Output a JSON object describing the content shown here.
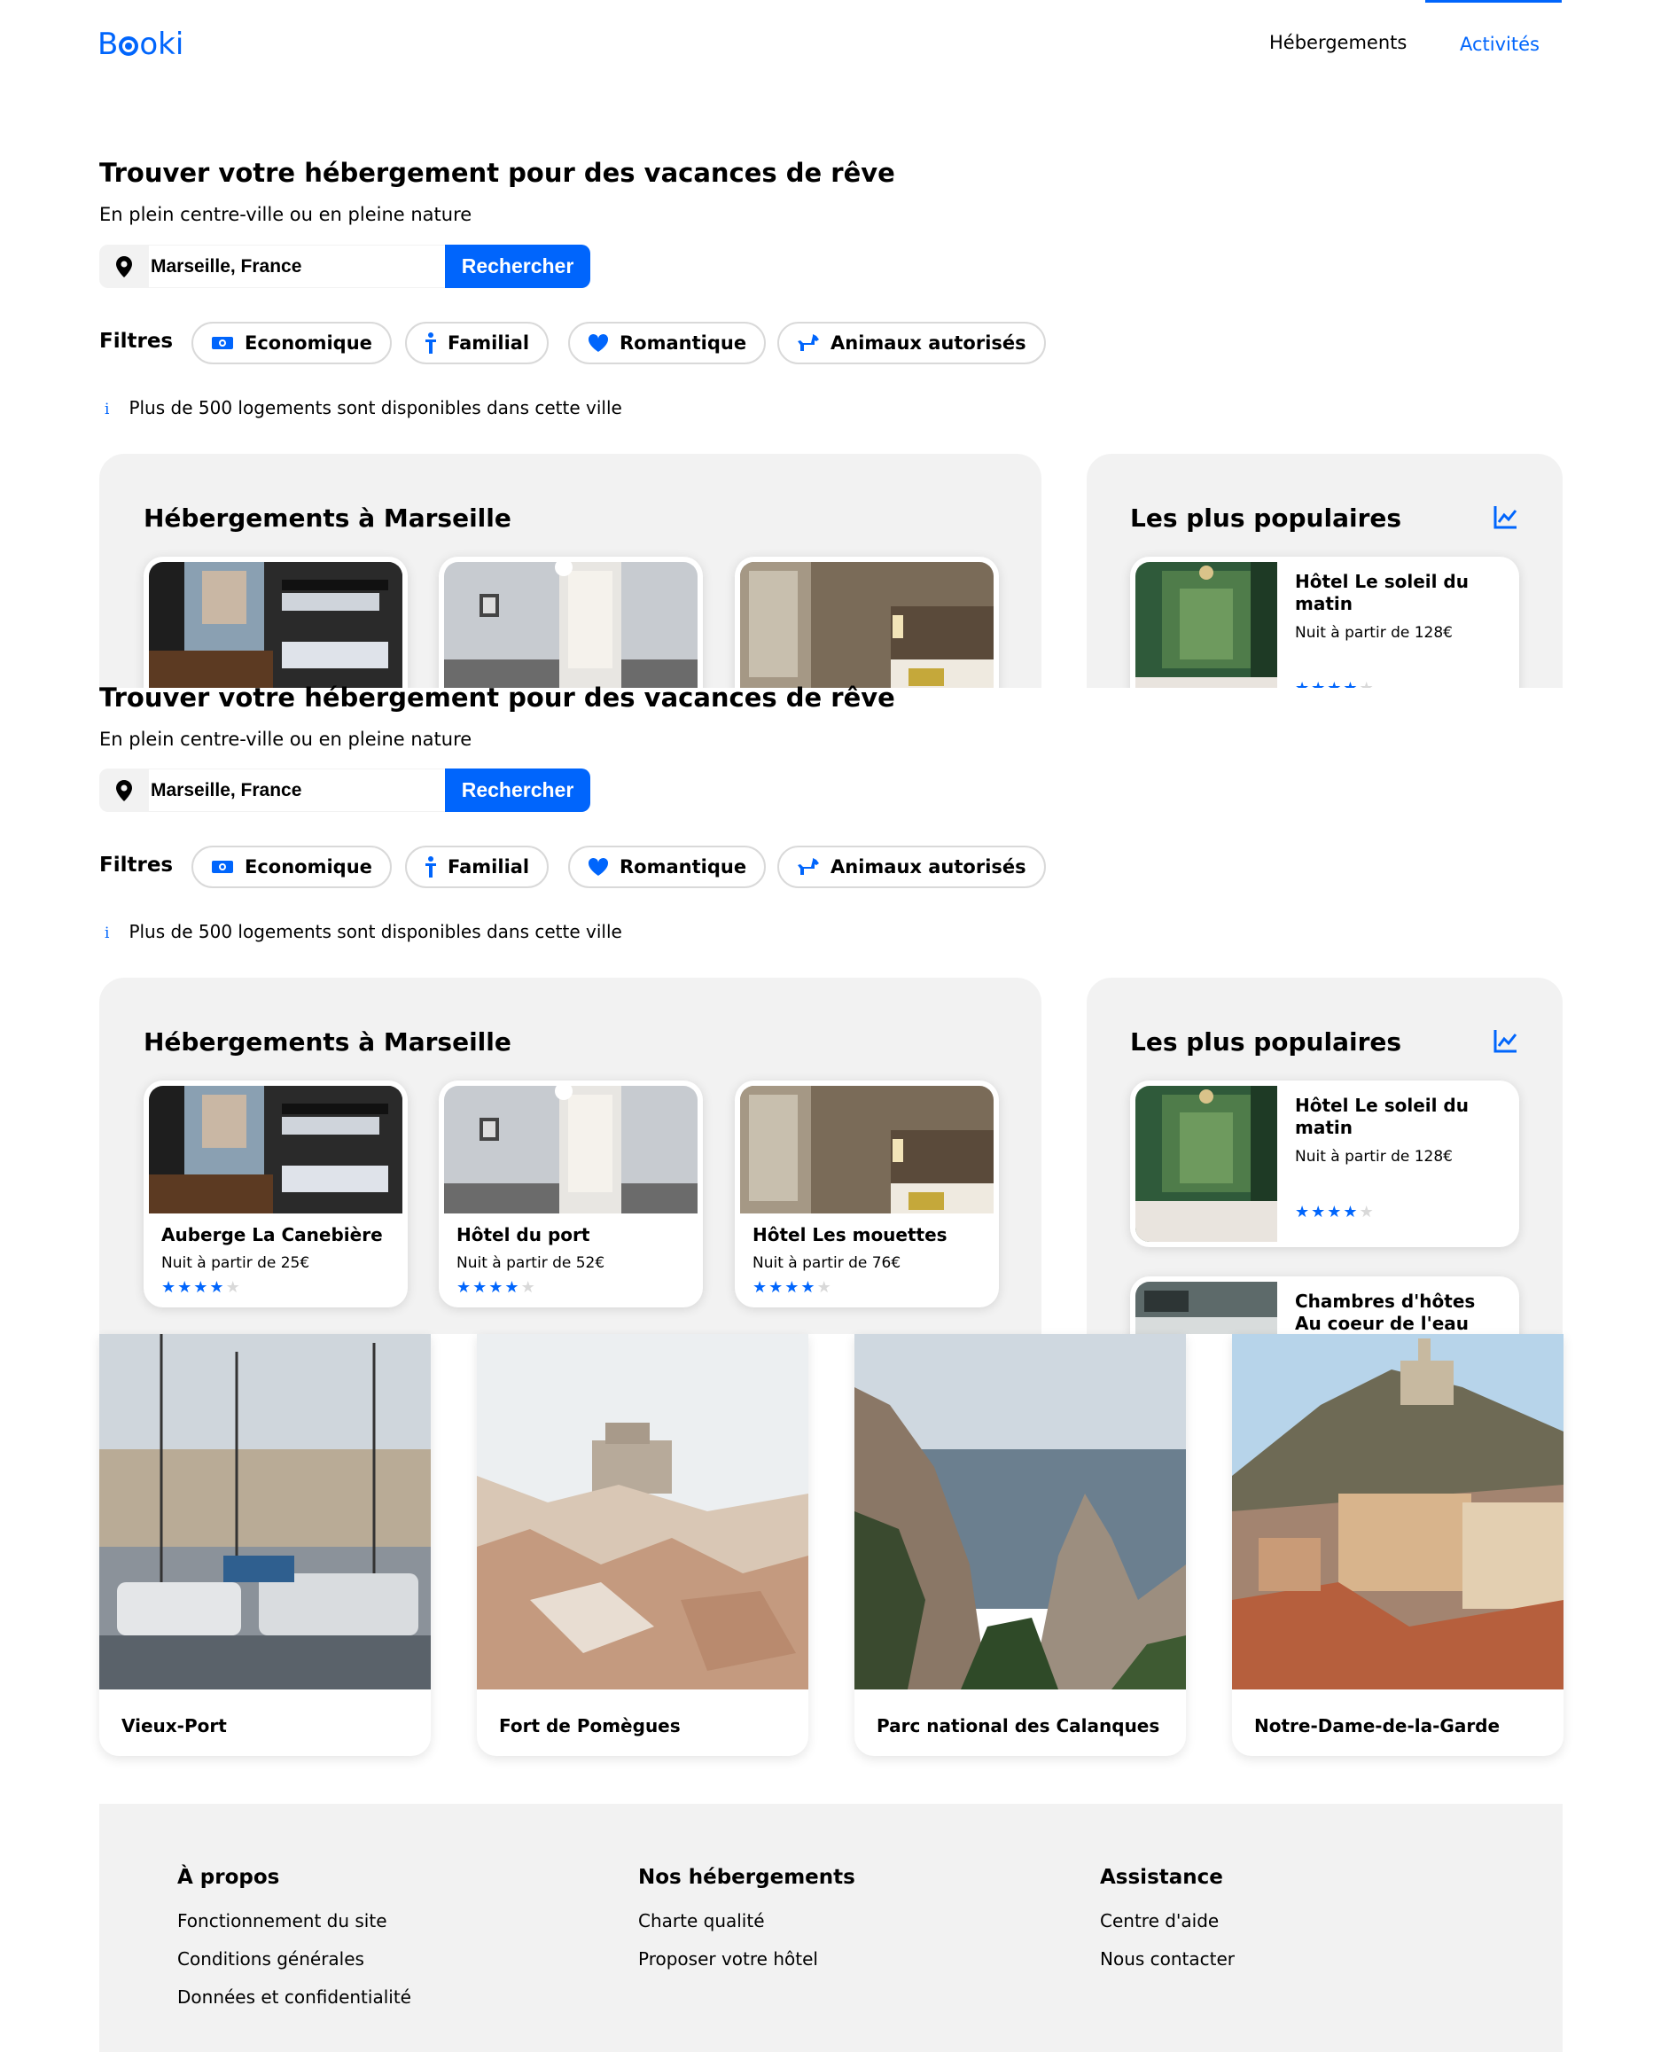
{
  "header": {
    "logo": "Booki",
    "nav": [
      "Hébergements",
      "Activités"
    ],
    "accent_color": "#0065FC"
  },
  "search": {
    "title": "Trouver votre hébergement pour des vacances de rêve",
    "subtitle": "En plein centre-ville ou en pleine nature",
    "location_icon": "map-pin-icon",
    "location_value": "Marseille, France",
    "button_label": "Rechercher"
  },
  "filters": {
    "label": "Filtres",
    "items": [
      {
        "label": "Economique",
        "icon": "money-icon"
      },
      {
        "label": "Familial",
        "icon": "child-icon"
      },
      {
        "label": "Romantique",
        "icon": "heart-icon"
      },
      {
        "label": "Animaux autorisés",
        "icon": "dog-icon"
      }
    ]
  },
  "info": {
    "icon": "info-icon",
    "text": "Plus de 500 logements sont disponibles dans cette ville"
  },
  "accommodations": {
    "title": "Hébergements à Marseille",
    "items": [
      {
        "name": "Auberge La Canebière",
        "price": "Nuit à partir de 25€",
        "rating": 4,
        "max_rating": 5
      },
      {
        "name": "Hôtel du port",
        "price": "Nuit à partir de 52€",
        "rating": 4,
        "max_rating": 5
      },
      {
        "name": "Hôtel Les mouettes",
        "price": "Nuit à partir de 76€",
        "rating": 4,
        "max_rating": 5
      }
    ]
  },
  "popular": {
    "title": "Les plus populaires",
    "icon": "trend-chart-icon",
    "items": [
      {
        "name": "Hôtel Le soleil du matin",
        "price": "Nuit à partir de 128€",
        "rating": 4,
        "max_rating": 5
      },
      {
        "name": "Chambres d'hôtes Au coeur de l'eau"
      }
    ]
  },
  "activities": {
    "items": [
      {
        "name": "Vieux-Port"
      },
      {
        "name": "Fort de Pomègues"
      },
      {
        "name": "Parc national des Calanques"
      },
      {
        "name": "Notre-Dame-de-la-Garde"
      }
    ]
  },
  "footer": {
    "columns": [
      {
        "title": "À propos",
        "links": [
          "Fonctionnement du site",
          "Conditions générales",
          "Données et confidentialité"
        ]
      },
      {
        "title": "Nos hébergements",
        "links": [
          "Charte qualité",
          "Proposer votre hôtel"
        ]
      },
      {
        "title": "Assistance",
        "links": [
          "Centre d'aide",
          "Nous contacter"
        ]
      }
    ]
  }
}
